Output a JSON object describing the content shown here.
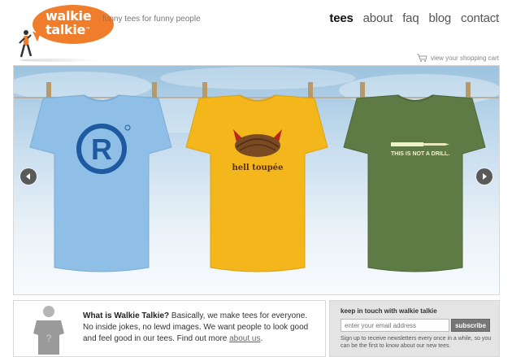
{
  "brand": {
    "name_line1": "walkie",
    "name_line2": "talkie",
    "trademark": "™",
    "tagline": "funny tees for funny people",
    "accent_color": "#ef7d2b"
  },
  "nav": {
    "items": [
      {
        "label": "tees",
        "active": true
      },
      {
        "label": "about",
        "active": false
      },
      {
        "label": "faq",
        "active": false
      },
      {
        "label": "blog",
        "active": false
      },
      {
        "label": "contact",
        "active": false
      }
    ]
  },
  "cart": {
    "icon": "shopping-cart-icon",
    "label": "view your shopping cart"
  },
  "carousel": {
    "prev_icon": "chevron-left-icon",
    "next_icon": "chevron-right-icon",
    "shirts": [
      {
        "name": "registered",
        "color": "#8fbfe6",
        "graphic": "registered-trademark-icon",
        "text": ""
      },
      {
        "name": "hell toupee",
        "color": "#f3b71c",
        "graphic": "horned-toupee-icon",
        "text": "hell toupée"
      },
      {
        "name": "not a drill",
        "color": "#5e7a45",
        "graphic": "screwdriver-icon",
        "text": "THIS IS NOT A DRILL."
      }
    ]
  },
  "about": {
    "question": "What is Walkie Talkie?",
    "body": " Basically, we make tees for everyone. No inside jokes, no lewd images. We want people to look good and feel good in our tees. Find out more ",
    "link_label": "about us",
    "end": "."
  },
  "newsletter": {
    "title": "keep in touch with walkie talkie",
    "placeholder": "enter your email address",
    "button_label": "subscribe",
    "description": "Sign up to receive newsletters every once in a while, so you can be the first to know about our new tees."
  }
}
